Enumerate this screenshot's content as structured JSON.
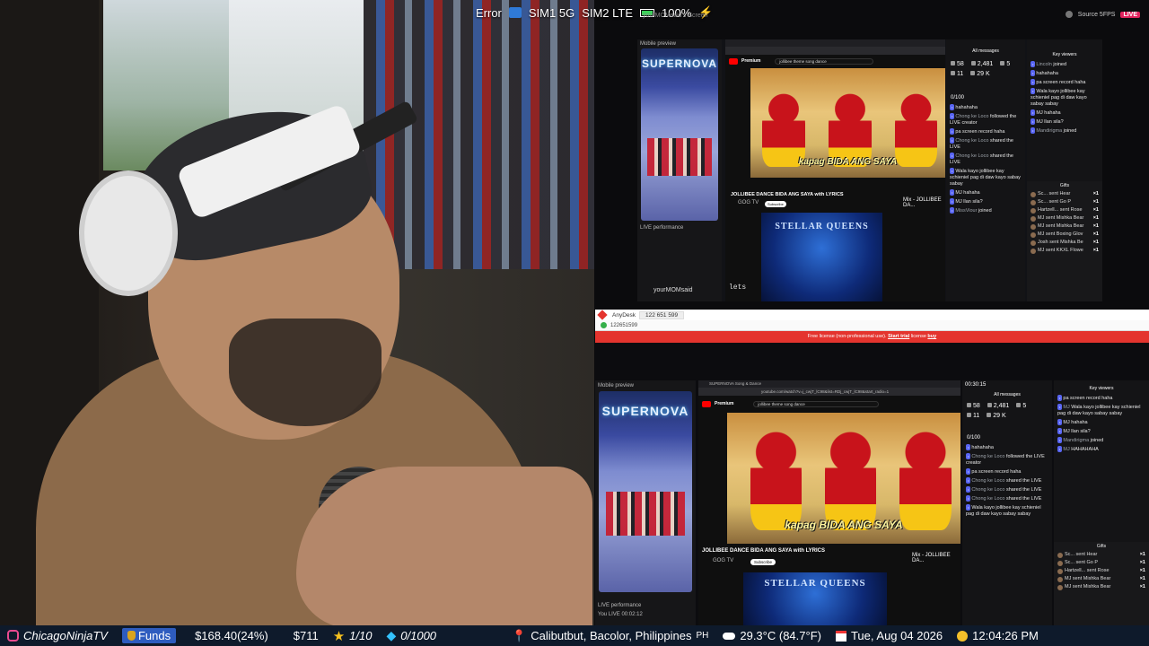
{
  "status_bar": {
    "error": "Error",
    "sim1": "SIM1 5G",
    "sim2": "SIM2 LTE",
    "battery": "100%",
    "screen_label": "yourMOMsaid's Screen",
    "source": "Source 5FPS",
    "live": "LIVE"
  },
  "top_window": {
    "preview_label": "Mobile preview",
    "phone_title": "SUPERNOVA",
    "search_text": "jollibee theme song dance",
    "premium_label": "Premium",
    "caption": "kapag BIDA ANG SAYA",
    "video_title": "JOLLIBEE DANCE BIDA ANG SAYA with LYRICS",
    "channel": "GOG TV",
    "subscribe": "Subscribe",
    "next_title": "Mix - JOLLIBEE DA...",
    "stellar": "STELLAR QUEENS",
    "stellar_text": "lets",
    "perf_label": "LIVE performance",
    "user": "yourMOMsaid",
    "stats": {
      "viewers": "58",
      "likes": "2,481",
      "rank": "5",
      "followers": "11",
      "coins": "29 K"
    },
    "goal": "0/100",
    "chat_header": "All messages",
    "chat": [
      {
        "who": "",
        "text": "hahahaha"
      },
      {
        "who": "Chong ke Loco",
        "text": "followed the LIVE creator"
      },
      {
        "who": "",
        "text": "pa screen record haha"
      },
      {
        "who": "Chong ke Loco",
        "text": "shared the LIVE"
      },
      {
        "who": "Chong ke Loco",
        "text": "shared the LIVE"
      },
      {
        "who": "",
        "text": "Wala kayo jollibee kay schieniel pag di daw kayo sabay sabay"
      },
      {
        "who": "",
        "text": "MJ hahaha"
      },
      {
        "who": "",
        "text": "MJ llan sila?"
      },
      {
        "who": "MissViour",
        "text": "joined"
      }
    ],
    "key_header": "Key viewers",
    "key_chat": [
      {
        "who": "Lincoln",
        "text": "joined"
      },
      {
        "who": "",
        "text": "hahahaha"
      },
      {
        "who": "",
        "text": "pa screen record haha"
      },
      {
        "who": "",
        "text": "Wala kayo jollibee kay schieniel pag di daw kayo sabay sabay"
      },
      {
        "who": "",
        "text": "MJ hahaha"
      },
      {
        "who": "",
        "text": "MJ llan sila?"
      },
      {
        "who": "Mandirigma",
        "text": "joined"
      }
    ],
    "gifts_header": "Gifts",
    "gifts": [
      {
        "text": "Sc... sent Hear",
        "x": "×1"
      },
      {
        "text": "Sc... sent Go P",
        "x": "×1"
      },
      {
        "text": "Hartzell... sent Rose",
        "x": "×1"
      },
      {
        "text": "MJ sent Mishka Bear",
        "x": "×1"
      },
      {
        "text": "MJ sent Mishka Bear",
        "x": "×1"
      },
      {
        "text": "MJ sent Boxing Glov",
        "x": "×1"
      },
      {
        "text": "Josh sent Mishka Be",
        "x": "×1"
      },
      {
        "text": "MJ sent KKXL Flowe",
        "x": "×1"
      }
    ]
  },
  "anydesk": {
    "app": "AnyDesk",
    "tab_id": "122 651 599",
    "address": "122651599",
    "banner_text": "Free license (non-professional use).",
    "banner_link1": "Start trial",
    "banner_mid": "license",
    "banner_link2": "buy",
    "remote": {
      "preview_label": "Mobile preview",
      "phone_title": "SUPERNOVA",
      "tab_label": "SUPERNOVA Song & Dance",
      "url": "youtube.com/watch?v=j_cwjT_lC98&list=RDj_cwjT_lC98&start_radio=1",
      "search_text": "jollibee theme song dance",
      "premium_label": "Premium",
      "caption": "kapag BIDA ANG SAYA",
      "video_title": "JOLLIBEE DANCE BIDA ANG SAYA with LYRICS",
      "channel": "GOG TV",
      "subscribe": "Subscribe",
      "next_title": "Mix - JOLLIBEE DA...",
      "stellar": "STELLAR QUEENS",
      "perf_label": "LIVE performance",
      "live_user": "You LIVE 00:02:12",
      "timer": "00:30:15",
      "stats": {
        "viewers": "58",
        "likes": "2,481",
        "rank": "5",
        "followers": "11",
        "coins": "29 K"
      },
      "goal": "0/100",
      "chat_header": "All messages",
      "chat": [
        {
          "who": "",
          "text": "hahahaha"
        },
        {
          "who": "Chong ke Loco",
          "text": "followed the LIVE creator"
        },
        {
          "who": "",
          "text": "pa screen record haha"
        },
        {
          "who": "Chong ke Loco",
          "text": "shared the LIVE"
        },
        {
          "who": "Chong ke Loco",
          "text": "shared the LIVE"
        },
        {
          "who": "Chong ke Loco",
          "text": "shared the LIVE"
        },
        {
          "who": "",
          "text": "Wala kayo jollibee kay schieniel pag di daw kayo sabay sabay"
        }
      ],
      "key_header": "Key viewers",
      "key_chat": [
        {
          "who": "",
          "text": "pa screen record haha"
        },
        {
          "who": "MJ",
          "text": "Wala kayo jollibee kay schieniel pag di daw kayo sabay sabay"
        },
        {
          "who": "",
          "text": "MJ hahaha"
        },
        {
          "who": "",
          "text": "MJ llan sila?"
        },
        {
          "who": "Mandirigma",
          "text": "joined"
        },
        {
          "who": "MJ",
          "text": "HAHAHAHA"
        }
      ],
      "gifts_header": "Gifts",
      "gifts": [
        {
          "text": "Sc... sent Hear",
          "x": "×1"
        },
        {
          "text": "Sc... sent Go P",
          "x": "×1"
        },
        {
          "text": "Hartzell... sent Rose",
          "x": "×1"
        },
        {
          "text": "MJ sent Mishka Bear",
          "x": "×1"
        },
        {
          "text": "MJ sent Mishka Bear",
          "x": "×1"
        }
      ]
    }
  },
  "ticker": {
    "channel": "ChicagoNinjaTV",
    "funds_label": "Funds",
    "funds_value": "$168.40(24%)",
    "cash": "$711",
    "stars": "1/10",
    "gems": "0/1000",
    "location": "Calibutbut, Bacolor, Philippines",
    "country": "PH",
    "weather": "29.3°C (84.7°F)",
    "date": "Tue, Aug 04 2026",
    "time": "12:04:26 PM"
  },
  "colors": {
    "ticker_bg": "#0e1a2b",
    "funds_bg": "#2e5cbf",
    "anydesk_red": "#e4342e",
    "youtube_red": "#ff0000",
    "caption_yellow": "#fff59d"
  }
}
